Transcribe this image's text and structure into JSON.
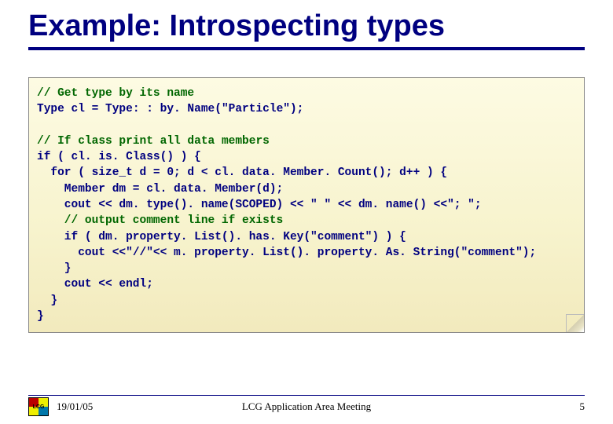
{
  "title": "Example: Introspecting types",
  "code": {
    "c1": "// Get type by its name",
    "l2a": "Type cl = Type: : by. Name(",
    "l2b": "\"Particle\"",
    "l2c": "); ",
    "c3": "// If class print all data members",
    "l4": "if ( cl. is. Class() ) {",
    "l5": "for ( size_t d = 0; d < cl. data. Member. Count(); d++ ) {",
    "l6": "Member dm = cl. data. Member(d);",
    "l7": "cout << dm. type(). name(SCOPED) << \" \" << dm. name() <<\"; \";",
    "c8": "// output comment line if exists",
    "l9": "if ( dm. property. List(). has. Key(\"comment\") ) {",
    "l10": "cout <<\"//\"<< m. property. List(). property. As. String(\"comment\");",
    "l11": "}",
    "l12": "cout << endl;",
    "l13": "}",
    "l14": "}"
  },
  "footer": {
    "logo_text": "LCG",
    "date": "19/01/05",
    "center": "LCG Application Area Meeting",
    "page": "5"
  }
}
